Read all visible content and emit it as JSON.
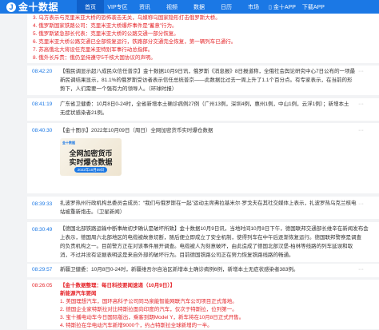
{
  "nav": {
    "logo_mark": "J",
    "logo_text": "金十数据",
    "items": [
      "首页",
      "VIP专区",
      "资讯",
      "视频",
      "数据",
      "日历",
      "市场"
    ],
    "app_label": "金十APP",
    "download_label": "下载APP"
  },
  "top_block": {
    "lines": [
      "3. 乌方表示与克里米亚大桥的恐怖袭击无关，乌媒称乌国家隐形打击俄罗斯大桥。",
      "4. 俄罗斯国家铁路公司：克里米亚大桥爆炸事件是“蓄意”行为。",
      "5. 俄罗斯紧急部长代表：克里米亚大桥的公路交通一部分恢复。",
      "6. 克里米亚大桥公路交通已全部恢复运行，铁路部分交通完全恢复，第一辆列车已通行。",
      "7. 苏高俄北大将设任克里米亚特别军事行动总指挥。",
      "8. 俄外长斥责：俄仍坚持遵守5千核大国协议的声明。"
    ]
  },
  "items": [
    {
      "time": "08:42:20",
      "lines": [
        "【俄民调显示超八成民众信任普京】金十数据10月9日讯，俄罗斯《消息报》8日报道称，全俄社会舆论研究中心7日公布的一项最",
        "新民调结果显示，81.1%的俄罗斯受访者表示信任总统普京——此数据比过去一周上升了1.1个百分点。有专家表示，在当前的形",
        "势下，人们需要一个强有力的领导人。（环球时报）"
      ]
    },
    {
      "time": "08:41:19",
      "lines": [
        "广东省卫健委：10月8日0-24时，全省新增本土确诊病例27例（广州13例，深圳4例，惠州1例，中山1例，云浮1例）；新增本土",
        "无症状感染者21例。"
      ]
    },
    {
      "time": "08:40:30",
      "lines": [
        "【金十图示】2022年10月09日（周日）全网加密货币实时爆仓数据"
      ],
      "thumb": {
        "logo": "金十数据",
        "title1": "全网加密货币",
        "title2": "实时爆仓数据",
        "date": "2022年10月09日"
      }
    },
    {
      "time": "08:39:33",
      "lines": [
        "扎波罗热州行政机构总委员会成员：“我们与俄罗斯在一起”运动主席弗拉基米尔·罗戈夫在其社交媒体上表示，扎波罗热乌克兰核电",
        "站被重新炮击。（卫星新闻）"
      ]
    },
    {
      "time": "08:30:49",
      "lines": [
        "【德国北部铁路运输中断事故初步确认是破坏所致】金十数据10月9日讯，当地时间10月8日下午，德国联邦交通部长维辛在新闻发布会",
        "上表示，德国周六北部地区的电缆被故意切断，随后便立即成立了安全机制，使得列车在中午后逐渐恢复运行。德国联邦警察是调查",
        "的负责机构之一。目前警方正在对该事件展开调查。电缆被人为刻意破坏，由此造成了德国北部汉堡-柏林等线路的列车延误和取",
        "消，不过并没有证据表明这是来自外部的破坏行为。目前德国铁路公司正在努力恢复铁路线路的畅通。"
      ]
    },
    {
      "time": "08:29:57",
      "lines": [
        "新疆卫健委：10月8日0-24时，新疆维吾尔自治区新增本土确诊病例6例，新增本土无症状感染者383例。"
      ]
    },
    {
      "time": "08:26:05",
      "red": true,
      "lines": [
        "【金十数据整理：每日科技要闻速递（10月9日）】",
        "新能源汽车要闻",
        "1. 美国理想汽车，国环高科子公司同马泉能智能网联汽车公司项目正式落地。",
        "2. 德国企业家特斯拉对比特斯拉面向印度的汽车，仅次于特斯拉，位列第一。",
        "3. 宝十播电动车今日国际版出，乘客到期Model Y，新车将在10月8日正式开售。",
        "4. 特斯拉在华电动汽车新增9000个，约占特斯拉全球新增的一半。"
      ]
    }
  ]
}
